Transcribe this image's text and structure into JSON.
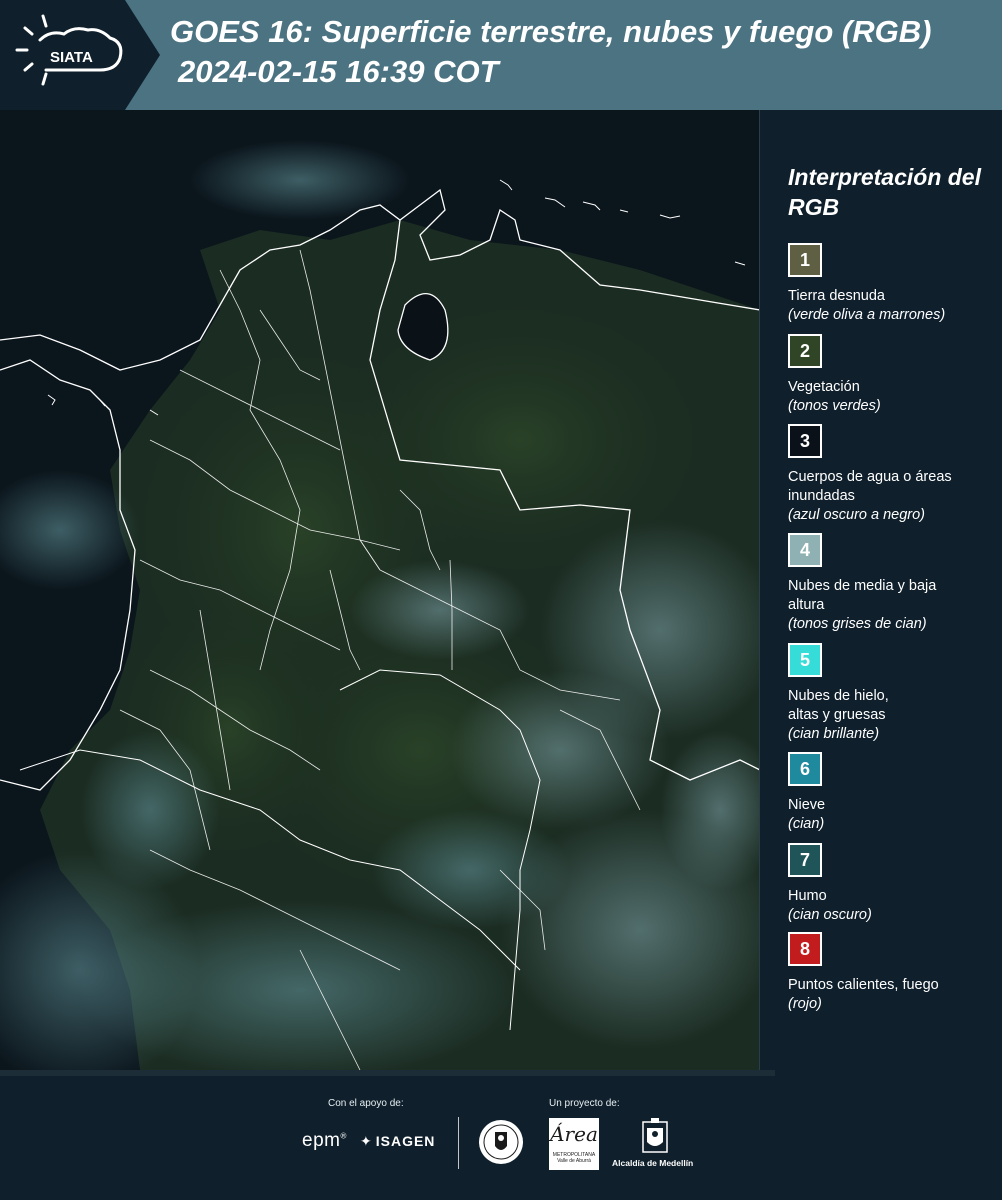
{
  "header": {
    "logo_text": "SIATA",
    "title_line1": "GOES 16: Superficie terrestre, nubes y fuego (RGB)",
    "title_line2": "2024-02-15 16:39 COT"
  },
  "legend": {
    "title": "Interpretación del RGB",
    "items": [
      {
        "number": "1",
        "label": "Tierra desnuda",
        "sub": "(verde oliva a marrones)",
        "color": "#5e5f43"
      },
      {
        "number": "2",
        "label": "Vegetación",
        "sub": "(tonos verdes)",
        "color": "#2f4526"
      },
      {
        "number": "3",
        "label": "Cuerpos de agua o áreas inundadas",
        "sub": "(azul oscuro a negro)",
        "color": "#0a1119"
      },
      {
        "number": "4",
        "label": "Nubes de media y baja altura",
        "sub": "(tonos grises de cian)",
        "color": "#8fb1b3"
      },
      {
        "number": "5",
        "label": "Nubes de hielo, altas y gruesas",
        "sub": "(cian brillante)",
        "color": "#36dcd8"
      },
      {
        "number": "6",
        "label": "Nieve",
        "sub": "(cian)",
        "color": "#1f8a9d"
      },
      {
        "number": "7",
        "label": "Humo",
        "sub": "(cian oscuro)",
        "color": "#1f5559"
      },
      {
        "number": "8",
        "label": "Puntos calientes, fuego",
        "sub": "(rojo)",
        "color": "#c21c1f"
      }
    ]
  },
  "footer": {
    "support_label": "Con el apoyo de:",
    "project_label": "Un proyecto de:",
    "epm": "epm",
    "isagen": "ISAGEN",
    "area_logo_big": "Área",
    "area_logo_small": "METROPOLITANA Valle de Aburrá",
    "alcaldia": "Alcaldía de Medellín"
  }
}
